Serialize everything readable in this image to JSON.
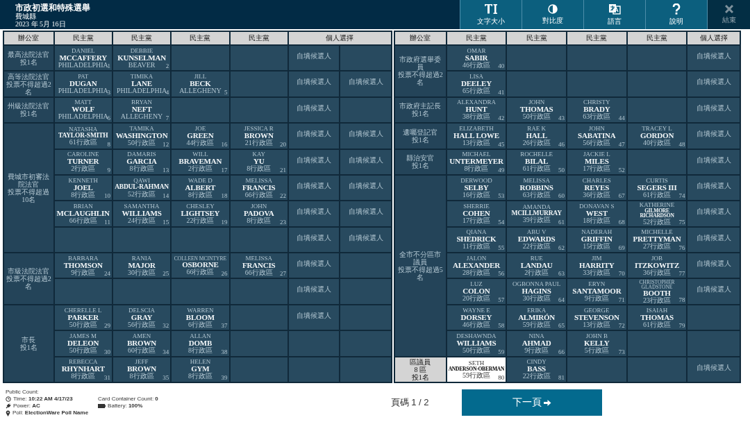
{
  "header": {
    "title": "市政初選和特殊選舉",
    "county": "費城縣",
    "date": "2023 年 5月 16日",
    "buttons": [
      {
        "kind": "text-size",
        "label": "文字大小",
        "disabled": false
      },
      {
        "kind": "contrast",
        "label": "對比度",
        "disabled": false
      },
      {
        "kind": "language",
        "label": "語言",
        "disabled": false
      },
      {
        "kind": "help",
        "label": "說明",
        "disabled": false
      },
      {
        "kind": "close",
        "label": "結束",
        "disabled": true
      }
    ]
  },
  "left_table": {
    "columns": [
      {
        "label": "辦公室"
      },
      {
        "label": "民主黨"
      },
      {
        "label": "民主黨"
      },
      {
        "label": "民主黨"
      },
      {
        "label": "民主黨"
      },
      {
        "label": "個人選擇"
      }
    ],
    "races": [
      {
        "office": "最高法院法官",
        "limit": "投1名",
        "lit": false,
        "rows": [
          {
            "candidates": [
              {
                "kind": "candidate",
                "first": "DANIEL",
                "last": "MCCAFFERY",
                "area": "PHILADELPHIA",
                "number": "1",
                "lit": false
              },
              {
                "kind": "candidate",
                "first": "DEBBIE",
                "last": "KUNSELMAN",
                "area": "BEAVER",
                "number": "2",
                "lit": false
              },
              {
                "kind": "empty"
              },
              {
                "kind": "empty"
              }
            ],
            "write_ins": [
              {
                "kind": "write_in",
                "label": "自填候選人"
              },
              {
                "kind": "empty"
              }
            ]
          }
        ]
      },
      {
        "office": "高等法院法官",
        "limit": "投票不得超過2名",
        "lit": false,
        "rows": [
          {
            "candidates": [
              {
                "kind": "candidate",
                "first": "PAT",
                "last": "DUGAN",
                "area": "PHILADELPHIA",
                "number": "3",
                "lit": false
              },
              {
                "kind": "candidate",
                "first": "TIMIKA",
                "last": "LANE",
                "area": "PHILADELPHIA",
                "number": "4",
                "lit": false
              },
              {
                "kind": "candidate",
                "first": "JILL",
                "last": "BECK",
                "area": "ALLEGHENY",
                "number": "5",
                "lit": false
              },
              {
                "kind": "empty"
              }
            ],
            "write_ins": [
              {
                "kind": "write_in",
                "label": "自填候選人"
              },
              {
                "kind": "write_in",
                "label": "自填候選人"
              }
            ]
          }
        ]
      },
      {
        "office": "州級法院法官",
        "limit": "投1名",
        "lit": false,
        "rows": [
          {
            "candidates": [
              {
                "kind": "candidate",
                "first": "MATT",
                "last": "WOLF",
                "area": "PHILADELPHIA",
                "number": "6",
                "lit": false
              },
              {
                "kind": "candidate",
                "first": "BRYAN",
                "last": "NEFT",
                "area": "ALLEGHENY",
                "number": "7",
                "lit": false
              },
              {
                "kind": "empty"
              },
              {
                "kind": "empty"
              }
            ],
            "write_ins": [
              {
                "kind": "write_in",
                "label": "自填候選人"
              },
              {
                "kind": "empty"
              }
            ]
          }
        ]
      },
      {
        "office": "費城市初審法院法官",
        "limit": "投票不得超過10名",
        "lit": false,
        "rows": [
          {
            "candidates": [
              {
                "kind": "candidate",
                "first": "NATASHA",
                "last": "TAYLOR-SMITH",
                "area": "61行政區",
                "number": "8",
                "lit": false
              },
              {
                "kind": "candidate",
                "first": "TAMIKA",
                "last": "WASHINGTON",
                "area": "50行政區",
                "number": "12",
                "lit": false
              },
              {
                "kind": "candidate",
                "first": "JOE",
                "last": "GREEN",
                "area": "44行政區",
                "number": "16",
                "lit": false
              },
              {
                "kind": "candidate",
                "first": "JESSICA R",
                "last": "BROWN",
                "area": "21行政區",
                "number": "20",
                "lit": false
              }
            ],
            "write_ins": [
              {
                "kind": "write_in",
                "label": "自填候選人"
              },
              {
                "kind": "write_in",
                "label": "自填候選人"
              }
            ]
          },
          {
            "candidates": [
              {
                "kind": "candidate",
                "first": "CAROLINE",
                "last": "TURNER",
                "area": "2行政區",
                "number": "9",
                "lit": false
              },
              {
                "kind": "candidate",
                "first": "DAMARIS",
                "last": "GARCIA",
                "area": "8行政區",
                "number": "13",
                "lit": false
              },
              {
                "kind": "candidate",
                "first": "WILL",
                "last": "BRAVEMAN",
                "area": "2行政區",
                "number": "17",
                "lit": false
              },
              {
                "kind": "candidate",
                "first": "KAY",
                "last": "YU",
                "area": "8行政區",
                "number": "21",
                "lit": false
              }
            ],
            "write_ins": [
              {
                "kind": "write_in",
                "label": "自填候選人"
              },
              {
                "kind": "write_in",
                "label": "自填候選人"
              }
            ]
          },
          {
            "candidates": [
              {
                "kind": "candidate",
                "first": "KENNETH",
                "last": "JOEL",
                "area": "8行政區",
                "number": "10",
                "lit": false
              },
              {
                "kind": "candidate",
                "first": "QAWI",
                "last": "ABDUL-RAHMAN",
                "area": "52行政區",
                "number": "14",
                "lit": false
              },
              {
                "kind": "candidate",
                "first": "WADE D",
                "last": "ALBERT",
                "area": "8行政區",
                "number": "18",
                "lit": false
              },
              {
                "kind": "candidate",
                "first": "MELISSA",
                "last": "FRANCIS",
                "area": "66行政區",
                "number": "22",
                "lit": false
              }
            ],
            "write_ins": [
              {
                "kind": "write_in",
                "label": "自填候選人"
              },
              {
                "kind": "write_in",
                "label": "自填候選人"
              }
            ]
          },
          {
            "candidates": [
              {
                "kind": "candidate",
                "first": "BRIAN",
                "last": "MCLAUGHLIN",
                "area": "66行政區",
                "number": "11",
                "lit": false
              },
              {
                "kind": "candidate",
                "first": "SAMANTHA",
                "last": "WILLIAMS",
                "area": "24行政區",
                "number": "15",
                "lit": false
              },
              {
                "kind": "candidate",
                "first": "CHESLEY",
                "last": "LIGHTSEY",
                "area": "22行政區",
                "number": "19",
                "lit": false
              },
              {
                "kind": "candidate",
                "first": "JOHN",
                "last": "PADOVA",
                "area": "8行政區",
                "number": "23",
                "lit": false
              }
            ],
            "write_ins": [
              {
                "kind": "write_in",
                "label": "自填候選人"
              },
              {
                "kind": "write_in",
                "label": "自填候選人"
              }
            ]
          },
          {
            "candidates": [
              {
                "kind": "empty"
              },
              {
                "kind": "empty"
              },
              {
                "kind": "empty"
              },
              {
                "kind": "empty"
              }
            ],
            "write_ins": [
              {
                "kind": "write_in",
                "label": "自填候選人"
              },
              {
                "kind": "write_in",
                "label": "自填候選人"
              }
            ]
          }
        ]
      },
      {
        "office": "市級法院法官",
        "limit": "投票不得超過2名",
        "lit": false,
        "rows": [
          {
            "candidates": [
              {
                "kind": "candidate",
                "first": "BARBARA",
                "last": "THOMSON",
                "area": "9行政區",
                "number": "24",
                "lit": false
              },
              {
                "kind": "candidate",
                "first": "RANIA",
                "last": "MAJOR",
                "area": "30行政區",
                "number": "25",
                "lit": false
              },
              {
                "kind": "candidate",
                "first": "COLLEEN MCINTYRE",
                "last": "OSBORNE",
                "area": "66行政區",
                "number": "26",
                "lit": false
              },
              {
                "kind": "candidate",
                "first": "MELISSA",
                "last": "FRANCIS",
                "area": "66行政區",
                "number": "27",
                "lit": false
              }
            ],
            "write_ins": [
              {
                "kind": "write_in",
                "label": "自填候選人"
              },
              {
                "kind": "empty"
              }
            ]
          },
          {
            "candidates": [
              {
                "kind": "empty"
              },
              {
                "kind": "empty"
              },
              {
                "kind": "empty"
              },
              {
                "kind": "empty"
              }
            ],
            "write_ins": [
              {
                "kind": "write_in",
                "label": "自填候選人"
              },
              {
                "kind": "empty"
              }
            ]
          }
        ]
      },
      {
        "office": "市長",
        "limit": "投1名",
        "lit": false,
        "rows": [
          {
            "candidates": [
              {
                "kind": "candidate",
                "first": "CHERELLE L",
                "last": "PARKER",
                "area": "50行政區",
                "number": "29",
                "lit": false
              },
              {
                "kind": "candidate",
                "first": "DELSCIA",
                "last": "GRAY",
                "area": "56行政區",
                "number": "32",
                "lit": false
              },
              {
                "kind": "candidate",
                "first": "WARREN",
                "last": "BLOOM",
                "area": "6行政區",
                "number": "37",
                "lit": false
              },
              {
                "kind": "empty"
              }
            ],
            "write_ins": [
              {
                "kind": "write_in",
                "label": "自填候選人"
              },
              {
                "kind": "empty"
              }
            ]
          },
          {
            "candidates": [
              {
                "kind": "candidate",
                "first": "JAMES M",
                "last": "DELEON",
                "area": "50行政區",
                "number": "30",
                "lit": false
              },
              {
                "kind": "candidate",
                "first": "AMEN",
                "last": "BROWN",
                "area": "60行政區",
                "number": "34",
                "lit": false
              },
              {
                "kind": "candidate",
                "first": "ALLAN",
                "last": "DOMB",
                "area": "8行政區",
                "number": "38",
                "lit": false
              },
              {
                "kind": "empty"
              }
            ],
            "write_ins": [
              {
                "kind": "empty"
              },
              {
                "kind": "empty"
              }
            ]
          },
          {
            "candidates": [
              {
                "kind": "candidate",
                "first": "REBECCA",
                "last": "RHYNHART",
                "area": "8行政區",
                "number": "31",
                "lit": false
              },
              {
                "kind": "candidate",
                "first": "JEFF",
                "last": "BROWN",
                "area": "8行政區",
                "number": "35",
                "lit": false
              },
              {
                "kind": "candidate",
                "first": "HELEN",
                "last": "GYM",
                "area": "8行政區",
                "number": "39",
                "lit": false
              },
              {
                "kind": "empty"
              }
            ],
            "write_ins": [
              {
                "kind": "empty"
              },
              {
                "kind": "empty"
              }
            ]
          }
        ]
      }
    ]
  },
  "right_table": {
    "columns": [
      {
        "label": "辦公室"
      },
      {
        "label": "民主黨"
      },
      {
        "label": "民主黨"
      },
      {
        "label": "民主黨"
      },
      {
        "label": "民主黨"
      },
      {
        "label": "個人選擇"
      }
    ],
    "races": [
      {
        "office": "市政府選舉委員",
        "limit": "投票不得超過2名",
        "lit": false,
        "rows": [
          {
            "candidates": [
              {
                "kind": "candidate",
                "first": "OMAR",
                "last": "SABIR",
                "area": "46行政區",
                "number": "40",
                "lit": false
              },
              {
                "kind": "empty"
              },
              {
                "kind": "empty"
              },
              {
                "kind": "empty"
              }
            ],
            "write_ins": [
              {
                "kind": "write_in",
                "label": "自填候選人"
              }
            ]
          },
          {
            "candidates": [
              {
                "kind": "candidate",
                "first": "LISA",
                "last": "DEELEY",
                "area": "65行政區",
                "number": "41",
                "lit": false
              },
              {
                "kind": "empty"
              },
              {
                "kind": "empty"
              },
              {
                "kind": "empty"
              }
            ],
            "write_ins": [
              {
                "kind": "write_in",
                "label": "自填候選人"
              }
            ]
          }
        ]
      },
      {
        "office": "市政府主記長",
        "limit": "投1名",
        "lit": false,
        "rows": [
          {
            "candidates": [
              {
                "kind": "candidate",
                "first": "ALEXANDRA",
                "last": "HUNT",
                "area": "38行政區",
                "number": "42",
                "lit": false
              },
              {
                "kind": "candidate",
                "first": "JOHN",
                "last": "THOMAS",
                "area": "50行政區",
                "number": "43",
                "lit": false
              },
              {
                "kind": "candidate",
                "first": "CHRISTY",
                "last": "BRADY",
                "area": "63行政區",
                "number": "44",
                "lit": false
              },
              {
                "kind": "empty"
              }
            ],
            "write_ins": [
              {
                "kind": "write_in",
                "label": "自填候選人"
              }
            ]
          }
        ]
      },
      {
        "office": "遺囑登記官",
        "limit": "投1名",
        "lit": false,
        "rows": [
          {
            "candidates": [
              {
                "kind": "candidate",
                "first": "ELIZABETH",
                "last": "HALL LOWE",
                "area": "13行政區",
                "number": "45",
                "lit": false
              },
              {
                "kind": "candidate",
                "first": "RAE K",
                "last": "HALL",
                "area": "26行政區",
                "number": "46",
                "lit": false
              },
              {
                "kind": "candidate",
                "first": "JOHN",
                "last": "SABATINA",
                "area": "56行政區",
                "number": "47",
                "lit": false
              },
              {
                "kind": "candidate",
                "first": "TRACEY L",
                "last": "GORDON",
                "area": "40行政區",
                "number": "48",
                "lit": false
              }
            ],
            "write_ins": [
              {
                "kind": "write_in",
                "label": "自填候選人"
              }
            ]
          }
        ]
      },
      {
        "office": "縣治安官",
        "limit": "投1名",
        "lit": false,
        "rows": [
          {
            "candidates": [
              {
                "kind": "candidate",
                "first": "MICHAEL",
                "last": "UNTERMEYER",
                "area": "8行政區",
                "number": "49",
                "lit": false
              },
              {
                "kind": "candidate",
                "first": "ROCHELLE",
                "last": "BILAL",
                "area": "61行政區",
                "number": "50",
                "lit": false
              },
              {
                "kind": "candidate",
                "first": "JACKIE L",
                "last": "MILES",
                "area": "17行政區",
                "number": "52",
                "lit": false
              },
              {
                "kind": "empty"
              }
            ],
            "write_ins": [
              {
                "kind": "write_in",
                "label": "自填候選人"
              }
            ]
          }
        ]
      },
      {
        "office": "全市不分區市議員",
        "limit": "投票不得超過5名",
        "lit": false,
        "rows": [
          {
            "candidates": [
              {
                "kind": "candidate",
                "first": "DERWOOD",
                "last": "SELBY",
                "area": "16行政區",
                "number": "53",
                "lit": false
              },
              {
                "kind": "candidate",
                "first": "MELISSA",
                "last": "ROBBINS",
                "area": "63行政區",
                "number": "60",
                "lit": false
              },
              {
                "kind": "candidate",
                "first": "CHARLES",
                "last": "REYES",
                "area": "36行政區",
                "number": "67",
                "lit": false
              },
              {
                "kind": "candidate",
                "first": "CURTIS",
                "last": "SEGERS III",
                "area": "61行政區",
                "number": "74",
                "lit": false
              }
            ],
            "write_ins": [
              {
                "kind": "write_in",
                "label": "自填候選人"
              }
            ]
          },
          {
            "candidates": [
              {
                "kind": "candidate",
                "first": "SHERRIE",
                "last": "COHEN",
                "area": "17行政區",
                "number": "54",
                "lit": false
              },
              {
                "kind": "candidate",
                "first": "AMANDA",
                "last": "MCILLMURRAY",
                "area": "39行政區",
                "number": "61",
                "lit": false
              },
              {
                "kind": "candidate",
                "first": "DONAVAN S",
                "last": "WEST",
                "area": "18行政區",
                "number": "68",
                "lit": false
              },
              {
                "kind": "candidate",
                "first": "KATHERINE",
                "last": "GILMORE RICHARDSON",
                "area": "52行政區",
                "number": "75",
                "lit": false
              }
            ],
            "write_ins": [
              {
                "kind": "write_in",
                "label": "自填候選人"
              }
            ]
          },
          {
            "candidates": [
              {
                "kind": "candidate",
                "first": "QIANA",
                "last": "SHEDRICK",
                "area": "11行政區",
                "number": "55",
                "lit": false
              },
              {
                "kind": "candidate",
                "first": "ABU V",
                "last": "EDWARDS",
                "area": "22行政區",
                "number": "62",
                "lit": false
              },
              {
                "kind": "candidate",
                "first": "NADERAH",
                "last": "GRIFFIN",
                "area": "15行政區",
                "number": "69",
                "lit": false
              },
              {
                "kind": "candidate",
                "first": "MICHELLE",
                "last": "PRETTYMAN",
                "area": "27行政區",
                "number": "76",
                "lit": false
              }
            ],
            "write_ins": [
              {
                "kind": "write_in",
                "label": "自填候選人"
              }
            ]
          },
          {
            "candidates": [
              {
                "kind": "candidate",
                "first": "JALON",
                "last": "ALEXANDER",
                "area": "28行政區",
                "number": "56",
                "lit": false
              },
              {
                "kind": "candidate",
                "first": "RUE",
                "last": "LANDAU",
                "area": "2行政區",
                "number": "63",
                "lit": false
              },
              {
                "kind": "candidate",
                "first": "JIM",
                "last": "HARRITY",
                "area": "33行政區",
                "number": "70",
                "lit": false
              },
              {
                "kind": "candidate",
                "first": "JOB",
                "last": "ITZKOWITZ",
                "area": "36行政區",
                "number": "77",
                "lit": false
              }
            ],
            "write_ins": [
              {
                "kind": "write_in",
                "label": "自填候選人"
              }
            ]
          },
          {
            "candidates": [
              {
                "kind": "candidate",
                "first": "LUZ",
                "last": "COLON",
                "area": "20行政區",
                "number": "57",
                "lit": false
              },
              {
                "kind": "candidate",
                "first": "OGBONNA PAUL",
                "last": "HAGINS",
                "area": "30行政區",
                "number": "64",
                "lit": false
              },
              {
                "kind": "candidate",
                "first": "ERYN",
                "last": "SANTAMOOR",
                "area": "9行政區",
                "number": "71",
                "lit": false
              },
              {
                "kind": "candidate",
                "first": "CHRISTOPHER GLADSTONE",
                "last": "BOOTH",
                "area": "23行政區",
                "number": "78",
                "lit": false
              }
            ],
            "write_ins": [
              {
                "kind": "write_in",
                "label": "自填候選人"
              }
            ]
          },
          {
            "candidates": [
              {
                "kind": "candidate",
                "first": "WAYNE E",
                "last": "DORSEY",
                "area": "46行政區",
                "number": "58",
                "lit": false
              },
              {
                "kind": "candidate",
                "first": "ERIKA",
                "last": "ALMIRÓN",
                "area": "59行政區",
                "number": "65",
                "lit": false
              },
              {
                "kind": "candidate",
                "first": "GEORGE",
                "last": "STEVENSON",
                "area": "13行政區",
                "number": "72",
                "lit": false
              },
              {
                "kind": "candidate",
                "first": "ISAIAH",
                "last": "THOMAS",
                "area": "61行政區",
                "number": "79",
                "lit": false
              }
            ],
            "write_ins": [
              {
                "kind": "empty"
              }
            ]
          },
          {
            "candidates": [
              {
                "kind": "candidate",
                "first": "DESHAWNDA",
                "last": "WILLIAMS",
                "area": "50行政區",
                "number": "59",
                "lit": false
              },
              {
                "kind": "candidate",
                "first": "NINA",
                "last": "AHMAD",
                "area": "9行政區",
                "number": "66",
                "lit": false
              },
              {
                "kind": "candidate",
                "first": "JOHN B",
                "last": "KELLY",
                "area": "5行政區",
                "number": "73",
                "lit": false
              },
              {
                "kind": "empty"
              }
            ],
            "write_ins": [
              {
                "kind": "empty"
              }
            ]
          }
        ]
      },
      {
        "office": "區議員",
        "district": "8 區",
        "limit": "投1名",
        "lit": true,
        "rows": [
          {
            "candidates": [
              {
                "kind": "candidate",
                "first": "SETH",
                "last": "ANDERSON-OBERMAN",
                "area": "59行政區",
                "number": "80",
                "lit": true
              },
              {
                "kind": "candidate",
                "first": "CINDY",
                "last": "BASS",
                "area": "22行政區",
                "number": "81",
                "lit": false
              },
              {
                "kind": "empty"
              },
              {
                "kind": "empty"
              }
            ],
            "write_ins": [
              {
                "kind": "write_in",
                "label": "自填候選人"
              }
            ]
          }
        ]
      }
    ]
  },
  "footer": {
    "public_count": "Public Count:",
    "status_left": [
      {
        "kind": "clock",
        "text": "Time: **10:22 AM 4/17/23**"
      },
      {
        "kind": "plug",
        "text": "Power: **AC**"
      },
      {
        "kind": "pin",
        "text": "Poll: **ElectionWare Poll Name**"
      }
    ],
    "status_right": [
      {
        "kind": "none",
        "text": "Card Container Count: **0**"
      },
      {
        "kind": "battery",
        "text": "Battery: **100%**"
      }
    ],
    "page": "頁碼 1 / 2",
    "next_button": "下一頁"
  }
}
